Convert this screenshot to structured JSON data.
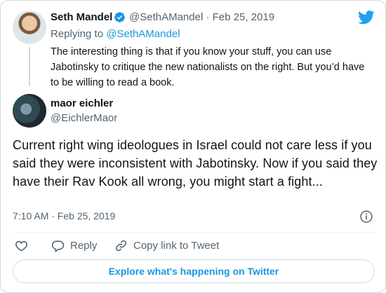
{
  "colors": {
    "accent": "#1b95e0",
    "muted": "#536471",
    "text": "#0f1419",
    "border": "#cfd9de"
  },
  "parent_tweet": {
    "author_name": "Seth Mandel",
    "author_handle": "@SethAMandel",
    "date": "· Feb 25, 2019",
    "replying_prefix": "Replying to",
    "replying_handle": "@SethAMandel",
    "text": "The interesting thing is that if you know your stuff, you can use Jabotinsky to critique the new nationalists on the right. But you’d have to be willing to read a book.",
    "verified_icon": "verified-badge-icon"
  },
  "tweet": {
    "author_name": "maor eichler",
    "author_handle": "@EichlerMaor",
    "text": "Current right wing ideologues in Israel could not care less if you said they were inconsistent with Jabotinsky. Now if you said they have their Rav Kook all wrong, you might start a fight...",
    "time": "7:10 AM · Feb 25, 2019"
  },
  "actions": {
    "reply_label": "Reply",
    "copy_label": "Copy link to Tweet"
  },
  "explore_label": "Explore what's happening on Twitter",
  "icons": [
    "twitter-bird-icon",
    "info-icon",
    "heart-icon",
    "reply-icon",
    "link-icon"
  ]
}
